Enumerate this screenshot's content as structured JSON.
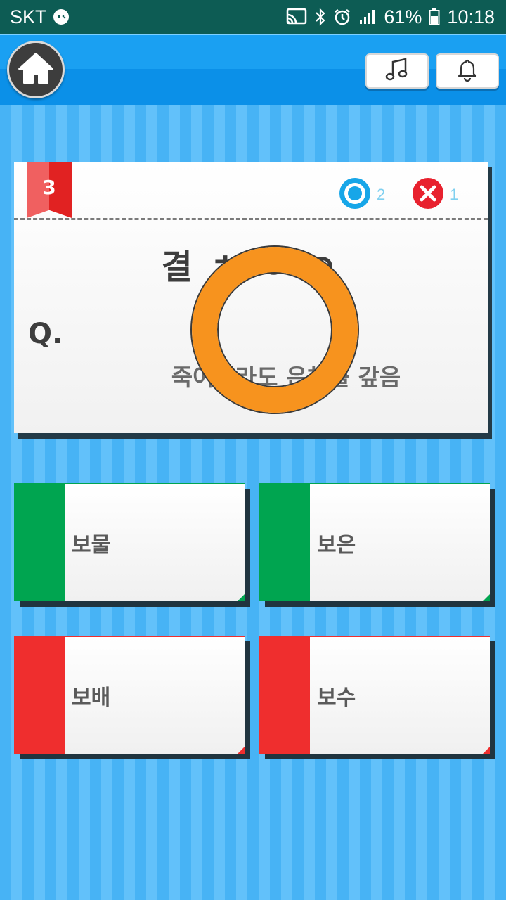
{
  "status_bar": {
    "carrier": "SKT",
    "battery": "61%",
    "time": "10:18"
  },
  "top_bar": {
    "home_icon": "home-icon",
    "music_icon": "music-note-icon",
    "bell_icon": "bell-icon"
  },
  "question": {
    "number": "3",
    "correct_count": "2",
    "wrong_count": "1",
    "title": "결 ㅊ ㅇ ㅇ",
    "label": "Q.",
    "text": "죽어서라도 은혜를 갚음"
  },
  "answers": [
    {
      "label": "보물",
      "color": "#00a550"
    },
    {
      "label": "보은",
      "color": "#00a550"
    },
    {
      "label": "보배",
      "color": "#ef2e2e"
    },
    {
      "label": "보수",
      "color": "#ef2e2e"
    }
  ],
  "colors": {
    "status_bar": "#0d5c54",
    "top_bar": "#1aa0f2",
    "result_ring": "#f7931e",
    "ribbon": "#e12222"
  }
}
